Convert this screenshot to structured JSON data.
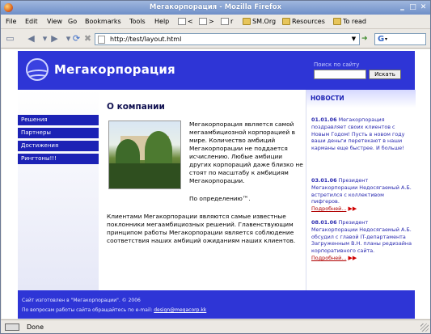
{
  "window": {
    "title": "Мегакорпорация - Mozilla Firefox"
  },
  "menu": {
    "items": [
      "File",
      "Edit",
      "View",
      "Go",
      "Bookmarks",
      "Tools",
      "Help"
    ]
  },
  "bookmarks": [
    {
      "label": "<",
      "icon": "page-icon"
    },
    {
      "label": ">",
      "icon": "page-icon"
    },
    {
      "label": "r",
      "icon": "page-icon"
    },
    {
      "label": "SM.Org",
      "icon": "folder-icon"
    },
    {
      "label": "Resources",
      "icon": "folder-icon"
    },
    {
      "label": "To read",
      "icon": "folder-icon"
    }
  ],
  "nav": {
    "url": "http://test/layout.html",
    "search_value": ""
  },
  "site": {
    "brand": "Мегакорпорация",
    "search_label": "Поиск по сайту",
    "search_button": "Искать",
    "menu": [
      "Решения",
      "Партнеры",
      "Достижения",
      "Рингтоны!!!"
    ],
    "page_title": "О компании",
    "para1": "Мегакорпорация является самой мегаамбициозной корпорацией в мире. Количество амбиций Мегакорпорации не поддается исчислению. Любые амбиции других корпораций даже близко не стоят по масштабу к амбициям Мегакорпорации.",
    "para2": "По определению™.",
    "para3": "Клиентами Мегакорпорации являются самые известные поклонники мегаамбициозных решений. Главенствующим принципом работы Мегакорпорации является соблюдение соответствия наших амбиций ожиданиям наших клиентов.",
    "news_title": "НОВОСТИ",
    "news": [
      {
        "date": "01.01.06",
        "text": "Мегакорпорация поздравляет своих клиентов с Новым Годом! Пусть в новом году ваши деньги перетекают в наши карманы еще быстрее. И больше!",
        "more": ""
      },
      {
        "date": "03.01.06",
        "text": "Президент Мегакорпорации Недосягаемый А.Б. встретился с коллективом пифгеров.",
        "more": "Подробней..."
      },
      {
        "date": "08.01.06",
        "text": "Президент Мегакорпорации Недосягаемый А.Б. обсудил с главой IT-департамента Загруженным В.Н. планы редизайна корпоративного сайта.",
        "more": "Подробней..."
      }
    ],
    "footer_line1": "Сайт изготовлен в \"Мегакорпорации\". © 2006",
    "footer_line2_prefix": "По вопросам работы сайта обращайтесь по e-mail:",
    "footer_email": "design@megacorp.kk"
  },
  "status": {
    "text": "Done"
  }
}
